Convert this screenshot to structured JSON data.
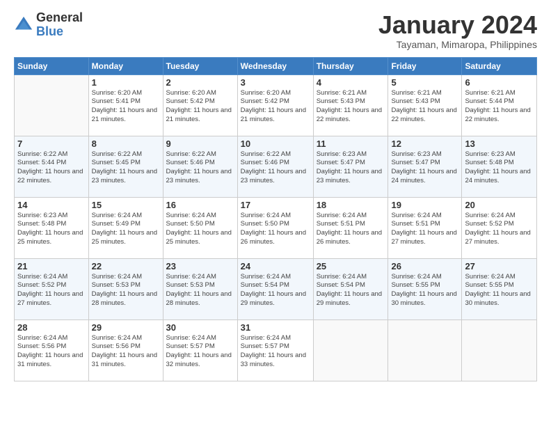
{
  "logo": {
    "general": "General",
    "blue": "Blue"
  },
  "title": "January 2024",
  "subtitle": "Tayaman, Mimaropa, Philippines",
  "headers": [
    "Sunday",
    "Monday",
    "Tuesday",
    "Wednesday",
    "Thursday",
    "Friday",
    "Saturday"
  ],
  "weeks": [
    [
      {
        "day": "",
        "info": ""
      },
      {
        "day": "1",
        "info": "Sunrise: 6:20 AM\nSunset: 5:41 PM\nDaylight: 11 hours\nand 21 minutes."
      },
      {
        "day": "2",
        "info": "Sunrise: 6:20 AM\nSunset: 5:42 PM\nDaylight: 11 hours\nand 21 minutes."
      },
      {
        "day": "3",
        "info": "Sunrise: 6:20 AM\nSunset: 5:42 PM\nDaylight: 11 hours\nand 21 minutes."
      },
      {
        "day": "4",
        "info": "Sunrise: 6:21 AM\nSunset: 5:43 PM\nDaylight: 11 hours\nand 22 minutes."
      },
      {
        "day": "5",
        "info": "Sunrise: 6:21 AM\nSunset: 5:43 PM\nDaylight: 11 hours\nand 22 minutes."
      },
      {
        "day": "6",
        "info": "Sunrise: 6:21 AM\nSunset: 5:44 PM\nDaylight: 11 hours\nand 22 minutes."
      }
    ],
    [
      {
        "day": "7",
        "info": "Sunrise: 6:22 AM\nSunset: 5:44 PM\nDaylight: 11 hours\nand 22 minutes."
      },
      {
        "day": "8",
        "info": "Sunrise: 6:22 AM\nSunset: 5:45 PM\nDaylight: 11 hours\nand 23 minutes."
      },
      {
        "day": "9",
        "info": "Sunrise: 6:22 AM\nSunset: 5:46 PM\nDaylight: 11 hours\nand 23 minutes."
      },
      {
        "day": "10",
        "info": "Sunrise: 6:22 AM\nSunset: 5:46 PM\nDaylight: 11 hours\nand 23 minutes."
      },
      {
        "day": "11",
        "info": "Sunrise: 6:23 AM\nSunset: 5:47 PM\nDaylight: 11 hours\nand 23 minutes."
      },
      {
        "day": "12",
        "info": "Sunrise: 6:23 AM\nSunset: 5:47 PM\nDaylight: 11 hours\nand 24 minutes."
      },
      {
        "day": "13",
        "info": "Sunrise: 6:23 AM\nSunset: 5:48 PM\nDaylight: 11 hours\nand 24 minutes."
      }
    ],
    [
      {
        "day": "14",
        "info": "Sunrise: 6:23 AM\nSunset: 5:48 PM\nDaylight: 11 hours\nand 25 minutes."
      },
      {
        "day": "15",
        "info": "Sunrise: 6:24 AM\nSunset: 5:49 PM\nDaylight: 11 hours\nand 25 minutes."
      },
      {
        "day": "16",
        "info": "Sunrise: 6:24 AM\nSunset: 5:50 PM\nDaylight: 11 hours\nand 25 minutes."
      },
      {
        "day": "17",
        "info": "Sunrise: 6:24 AM\nSunset: 5:50 PM\nDaylight: 11 hours\nand 26 minutes."
      },
      {
        "day": "18",
        "info": "Sunrise: 6:24 AM\nSunset: 5:51 PM\nDaylight: 11 hours\nand 26 minutes."
      },
      {
        "day": "19",
        "info": "Sunrise: 6:24 AM\nSunset: 5:51 PM\nDaylight: 11 hours\nand 27 minutes."
      },
      {
        "day": "20",
        "info": "Sunrise: 6:24 AM\nSunset: 5:52 PM\nDaylight: 11 hours\nand 27 minutes."
      }
    ],
    [
      {
        "day": "21",
        "info": "Sunrise: 6:24 AM\nSunset: 5:52 PM\nDaylight: 11 hours\nand 27 minutes."
      },
      {
        "day": "22",
        "info": "Sunrise: 6:24 AM\nSunset: 5:53 PM\nDaylight: 11 hours\nand 28 minutes."
      },
      {
        "day": "23",
        "info": "Sunrise: 6:24 AM\nSunset: 5:53 PM\nDaylight: 11 hours\nand 28 minutes."
      },
      {
        "day": "24",
        "info": "Sunrise: 6:24 AM\nSunset: 5:54 PM\nDaylight: 11 hours\nand 29 minutes."
      },
      {
        "day": "25",
        "info": "Sunrise: 6:24 AM\nSunset: 5:54 PM\nDaylight: 11 hours\nand 29 minutes."
      },
      {
        "day": "26",
        "info": "Sunrise: 6:24 AM\nSunset: 5:55 PM\nDaylight: 11 hours\nand 30 minutes."
      },
      {
        "day": "27",
        "info": "Sunrise: 6:24 AM\nSunset: 5:55 PM\nDaylight: 11 hours\nand 30 minutes."
      }
    ],
    [
      {
        "day": "28",
        "info": "Sunrise: 6:24 AM\nSunset: 5:56 PM\nDaylight: 11 hours\nand 31 minutes."
      },
      {
        "day": "29",
        "info": "Sunrise: 6:24 AM\nSunset: 5:56 PM\nDaylight: 11 hours\nand 31 minutes."
      },
      {
        "day": "30",
        "info": "Sunrise: 6:24 AM\nSunset: 5:57 PM\nDaylight: 11 hours\nand 32 minutes."
      },
      {
        "day": "31",
        "info": "Sunrise: 6:24 AM\nSunset: 5:57 PM\nDaylight: 11 hours\nand 33 minutes."
      },
      {
        "day": "",
        "info": ""
      },
      {
        "day": "",
        "info": ""
      },
      {
        "day": "",
        "info": ""
      }
    ]
  ]
}
